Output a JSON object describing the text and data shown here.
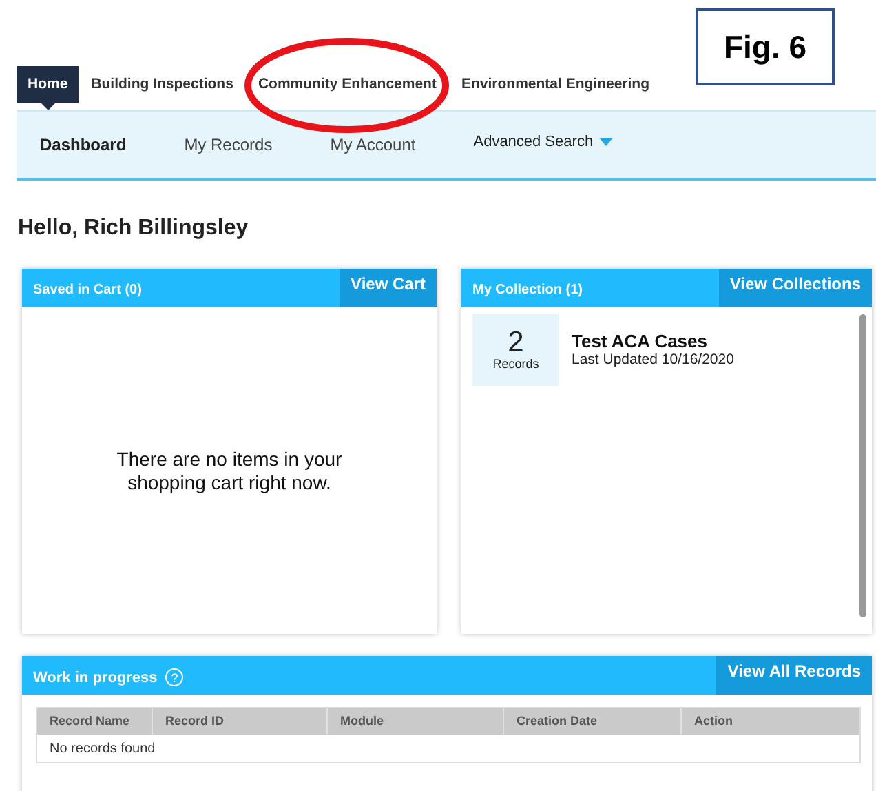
{
  "annotation": {
    "label": "Fig. 6"
  },
  "top_tabs": [
    {
      "label": "Home",
      "selected": true
    },
    {
      "label": "Building Inspections",
      "selected": false
    },
    {
      "label": "Community Enhancement",
      "selected": false
    },
    {
      "label": "Environmental Engineering",
      "selected": false
    }
  ],
  "sub_nav": [
    {
      "label": "Dashboard",
      "selected": true,
      "dropdown": false
    },
    {
      "label": "My Records",
      "selected": false,
      "dropdown": false
    },
    {
      "label": "My Account",
      "selected": false,
      "dropdown": false
    },
    {
      "label": "Advanced Search",
      "selected": false,
      "dropdown": true
    }
  ],
  "greeting": "Hello, Rich Billingsley",
  "cart": {
    "title": "Saved in Cart (0)",
    "button": "View Cart",
    "message": "There are no items in your shopping cart right now."
  },
  "collection": {
    "title": "My Collection (1)",
    "button": "View Collections",
    "items": [
      {
        "count": "2",
        "unit": "Records",
        "name": "Test ACA Cases",
        "updated": "Last Updated 10/16/2020"
      }
    ]
  },
  "work": {
    "title": "Work in progress",
    "help": "?",
    "button": "View All Records",
    "columns": [
      "Record Name",
      "Record ID",
      "Module",
      "Creation Date",
      "Action"
    ],
    "empty": "No records found"
  }
}
